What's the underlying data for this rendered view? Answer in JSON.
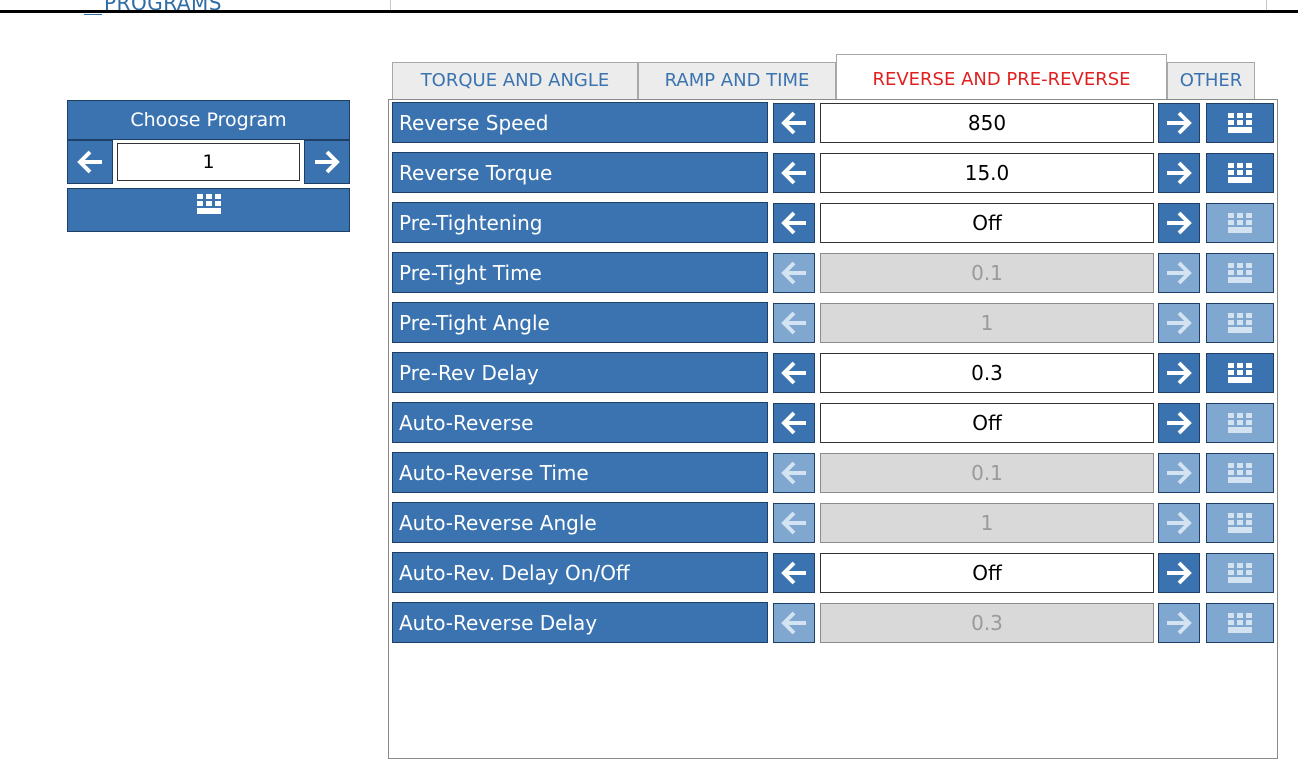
{
  "header": {
    "section_title": "PROGRAMS"
  },
  "chooser": {
    "title": "Choose Program",
    "value": "1",
    "prev_icon": "arrow-left-icon",
    "next_icon": "arrow-right-icon",
    "keypad_icon": "keypad-icon"
  },
  "tabs": [
    {
      "label": "TORQUE AND ANGLE",
      "active": false
    },
    {
      "label": "RAMP AND TIME",
      "active": false
    },
    {
      "label": "REVERSE AND PRE-REVERSE",
      "active": true
    },
    {
      "label": "OTHER",
      "active": false
    }
  ],
  "params": [
    {
      "label": "Reverse Speed",
      "value": "850",
      "enabled": true,
      "keypad_enabled": true
    },
    {
      "label": "Reverse Torque",
      "value": "15.0",
      "enabled": true,
      "keypad_enabled": true
    },
    {
      "label": "Pre-Tightening",
      "value": "Off",
      "enabled": true,
      "keypad_enabled": false
    },
    {
      "label": "Pre-Tight Time",
      "value": "0.1",
      "enabled": false,
      "keypad_enabled": false
    },
    {
      "label": "Pre-Tight Angle",
      "value": "1",
      "enabled": false,
      "keypad_enabled": false
    },
    {
      "label": "Pre-Rev Delay",
      "value": "0.3",
      "enabled": true,
      "keypad_enabled": true
    },
    {
      "label": "Auto-Reverse",
      "value": "Off",
      "enabled": true,
      "keypad_enabled": false
    },
    {
      "label": "Auto-Reverse Time",
      "value": "0.1",
      "enabled": false,
      "keypad_enabled": false
    },
    {
      "label": "Auto-Reverse Angle",
      "value": "1",
      "enabled": false,
      "keypad_enabled": false
    },
    {
      "label": "Auto-Rev. Delay On/Off",
      "value": "Off",
      "enabled": true,
      "keypad_enabled": false
    },
    {
      "label": "Auto-Reverse Delay",
      "value": "0.3",
      "enabled": false,
      "keypad_enabled": false
    }
  ],
  "colors": {
    "accent": "#3a73b0",
    "accent_disabled": "#7fa7cf",
    "active_tab_text": "#e02020",
    "disabled_field": "#d9d9d9"
  }
}
